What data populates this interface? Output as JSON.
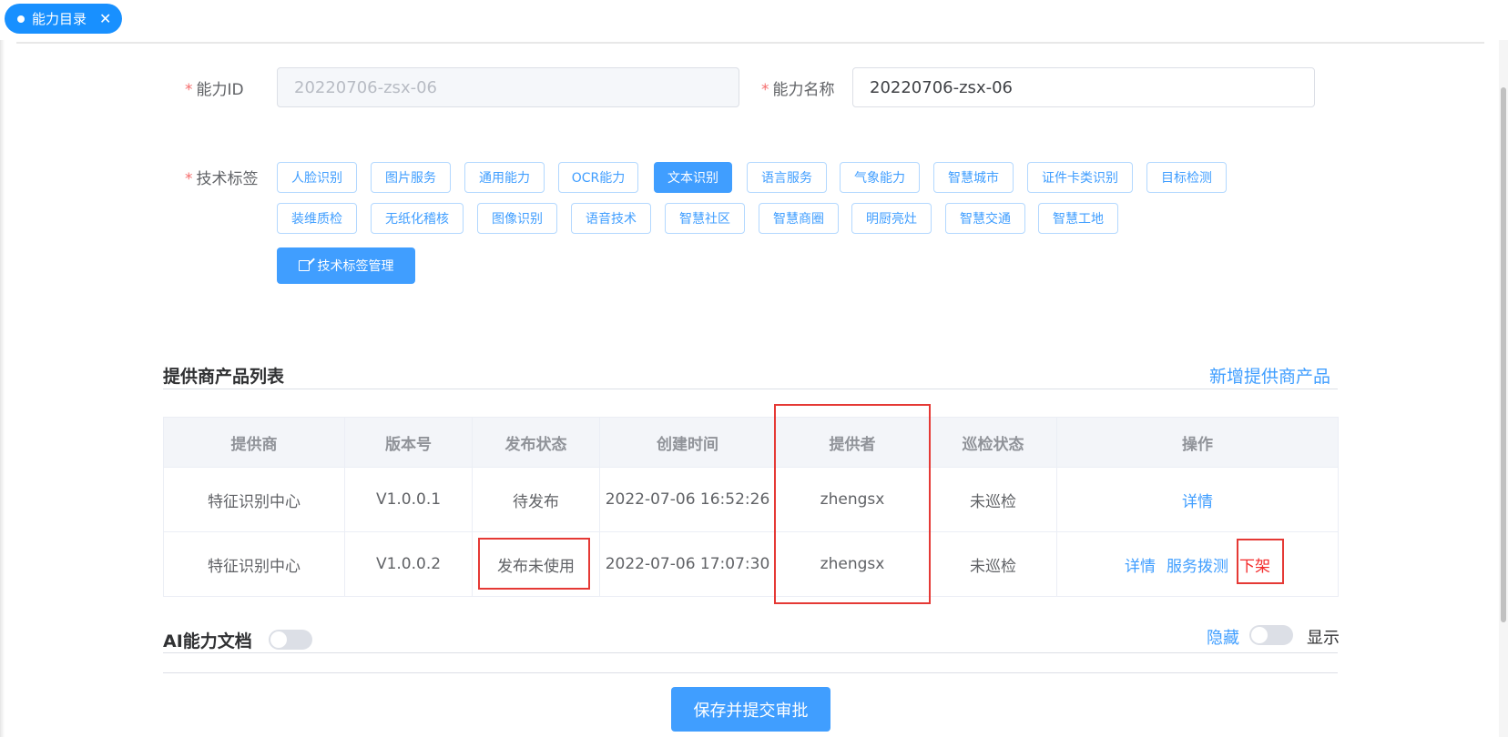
{
  "tab": {
    "label": "能力目录",
    "close": "✕"
  },
  "form": {
    "id_label": "能力ID",
    "id_value": "20220706-zsx-06",
    "name_label": "能力名称",
    "name_value": "20220706-zsx-06",
    "tags_label": "技术标签",
    "required_mark": "*",
    "tags_row1": [
      "人脸识别",
      "图片服务",
      "通用能力",
      "OCR能力",
      "文本识别",
      "语言服务",
      "气象能力",
      "智慧城市",
      "证件卡类识别",
      "目标检测"
    ],
    "tags_row2": [
      "装维质检",
      "无纸化稽核",
      "图像识别",
      "语音技术",
      "智慧社区",
      "智慧商圈",
      "明厨亮灶",
      "智慧交通",
      "智慧工地"
    ],
    "active_tag": "文本识别",
    "manage_button": "技术标签管理"
  },
  "providers": {
    "title": "提供商产品列表",
    "add_link": "新增提供商产品",
    "columns": [
      "提供商",
      "版本号",
      "发布状态",
      "创建时间",
      "提供者",
      "巡检状态",
      "操作"
    ],
    "rows": [
      {
        "provider": "特征识别中心",
        "version": "V1.0.0.1",
        "status": "待发布",
        "created": "2022-07-06 16:52:26",
        "owner": "zhengsx",
        "inspection": "未巡检",
        "ops": [
          "详情"
        ]
      },
      {
        "provider": "特征识别中心",
        "version": "V1.0.0.2",
        "status": "发布未使用",
        "created": "2022-07-06 17:07:30",
        "owner": "zhengsx",
        "inspection": "未巡检",
        "ops": [
          "详情",
          "服务拨测",
          "下架"
        ]
      }
    ]
  },
  "docs": {
    "title": "AI能力文档",
    "hide_label": "隐藏",
    "show_label": "显示"
  },
  "footer": {
    "submit_button": "保存并提交审批"
  },
  "colors": {
    "primary": "#409eff",
    "danger": "#f32a2a",
    "highlight_box": "#e53935"
  }
}
